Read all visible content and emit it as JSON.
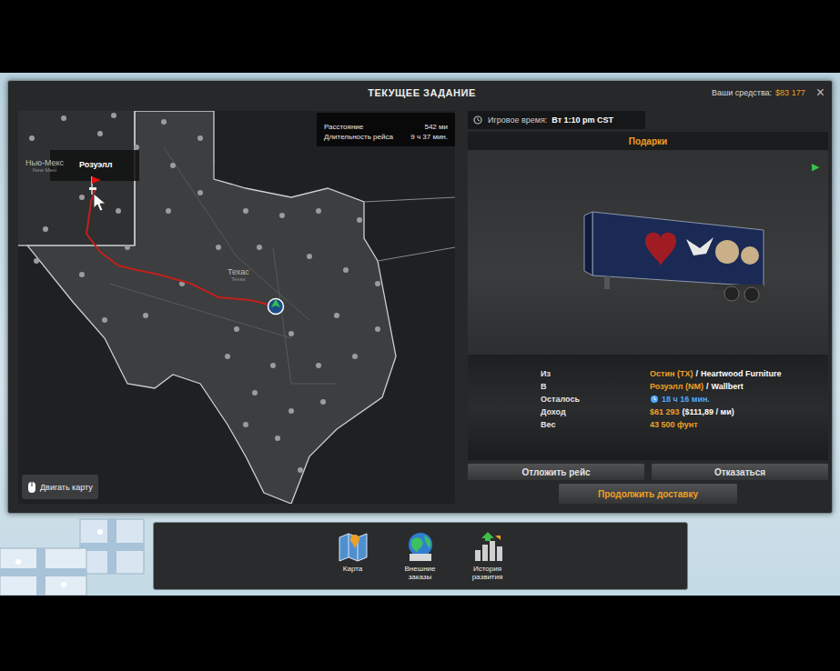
{
  "window": {
    "title": "ТЕКУЩЕЕ ЗАДАНИЕ",
    "close": "×"
  },
  "funds": {
    "label": "Ваши средства:",
    "value": "$83 177"
  },
  "map": {
    "state_labels": [
      {
        "name": "Нью-Мекс",
        "sub": "New Mexi"
      },
      {
        "name": "Техас",
        "sub": "Texas"
      }
    ],
    "destination": "Розуэлл",
    "route_info": [
      {
        "label": "Расстояние",
        "value": "542 ми"
      },
      {
        "label": "Длительность рейса",
        "value": "9 ч 37 мин."
      }
    ],
    "move_button": "Двигать карту"
  },
  "game_time": {
    "label": "Игровое время:",
    "value": "Вт 1:10 pm CST"
  },
  "cargo": {
    "name": "Подарки",
    "next": "▶"
  },
  "details": [
    {
      "kind": "place",
      "label": "Из",
      "value": "Остин (TX)",
      "separator": "/",
      "extra": "Heartwood Furniture"
    },
    {
      "kind": "place",
      "label": "В",
      "value": "Розуэлл (NM)",
      "separator": "/",
      "extra": "Wallbert"
    },
    {
      "kind": "time",
      "label": "Осталось",
      "value": "18 ч 16 мин."
    },
    {
      "kind": "money",
      "label": "Доход",
      "value": "$61 293",
      "extra": "($111,89 / ми)"
    },
    {
      "kind": "plain",
      "label": "Вес",
      "value": "43 500 фунт"
    }
  ],
  "buttons": [
    {
      "label": "Отложить рейс"
    },
    {
      "label": "Отказаться"
    }
  ],
  "primary_button": "Продолжить доставку",
  "dock": [
    {
      "label": "Карта"
    },
    {
      "label": "Внешние заказы"
    },
    {
      "label": "История развития"
    }
  ]
}
